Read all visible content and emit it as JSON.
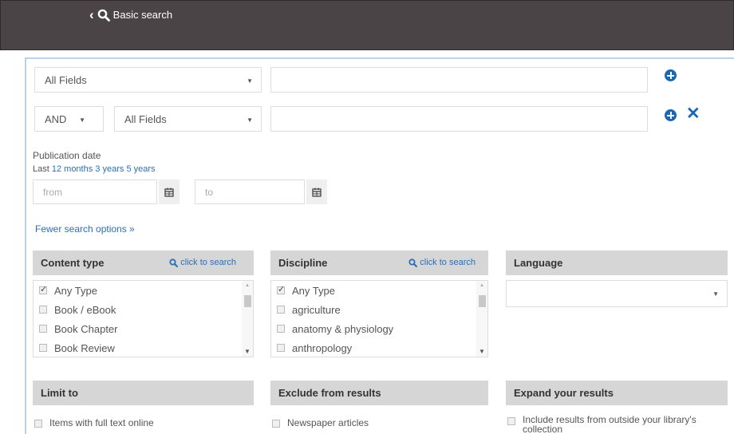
{
  "header": {
    "back_label": "Basic search"
  },
  "search": {
    "row1": {
      "field_select": "All Fields"
    },
    "row2": {
      "operator_select": "AND",
      "field_select": "All Fields"
    }
  },
  "publication_date": {
    "label": "Publication date",
    "last_label": "Last",
    "options": [
      "12 months",
      "3 years",
      "5 years"
    ],
    "from_placeholder": "from",
    "to_placeholder": "to"
  },
  "fewer_options": "Fewer search options »",
  "facets": {
    "content_type": {
      "title": "Content type",
      "search_link": "click to search",
      "items": [
        {
          "label": "Any Type",
          "checked": true
        },
        {
          "label": "Book / eBook",
          "checked": false
        },
        {
          "label": "Book Chapter",
          "checked": false
        },
        {
          "label": "Book Review",
          "checked": false
        }
      ]
    },
    "discipline": {
      "title": "Discipline",
      "search_link": "click to search",
      "items": [
        {
          "label": "Any Type",
          "checked": true
        },
        {
          "label": "agriculture",
          "checked": false
        },
        {
          "label": "anatomy & physiology",
          "checked": false
        },
        {
          "label": "anthropology",
          "checked": false
        }
      ]
    },
    "language": {
      "title": "Language",
      "selected": ""
    }
  },
  "bottom": {
    "limit_to": {
      "title": "Limit to",
      "item": "Items with full text online"
    },
    "exclude": {
      "title": "Exclude from results",
      "item": "Newspaper articles"
    },
    "expand": {
      "title": "Expand your results",
      "item": "Include results from outside your library's collection"
    }
  },
  "colors": {
    "accent": "#1a67b3",
    "topbar": "#4a4447",
    "facet_header": "#d6d6d6"
  }
}
